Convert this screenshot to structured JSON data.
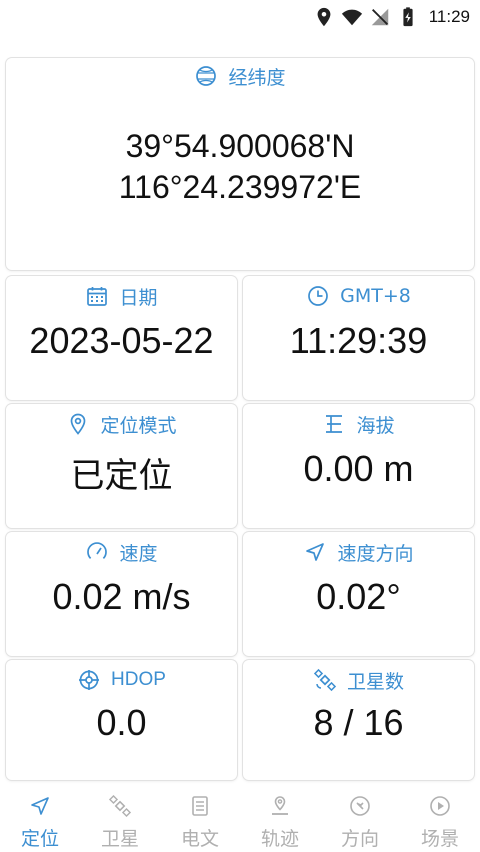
{
  "status_bar": {
    "time": "11:29"
  },
  "coordinates": {
    "label": "经纬度",
    "latitude": "39°54.900068'N",
    "longitude": "116°24.239972'E"
  },
  "cards": {
    "date": {
      "label": "日期",
      "value": "2023-05-22"
    },
    "timezone": {
      "label": "GMT+8",
      "value": "11:29:39"
    },
    "fix_mode": {
      "label": "定位模式",
      "value": "已定位"
    },
    "altitude": {
      "label": "海拔",
      "value": "0.00 m"
    },
    "speed": {
      "label": "速度",
      "value": "0.02 m/s"
    },
    "heading": {
      "label": "速度方向",
      "value": "0.02°"
    },
    "hdop": {
      "label": "HDOP",
      "value": "0.0"
    },
    "satellites": {
      "label": "卫星数",
      "value": "8 / 16"
    }
  },
  "nav": [
    {
      "label": "定位",
      "icon": "navigation-arrow-icon",
      "active": true
    },
    {
      "label": "卫星",
      "icon": "satellite-icon",
      "active": false
    },
    {
      "label": "电文",
      "icon": "document-icon",
      "active": false
    },
    {
      "label": "轨迹",
      "icon": "map-pin-track-icon",
      "active": false
    },
    {
      "label": "方向",
      "icon": "compass-icon",
      "active": false
    },
    {
      "label": "场景",
      "icon": "play-circle-icon",
      "active": false
    }
  ],
  "colors": {
    "accent": "#3d8fd1",
    "inactive": "#b0b0b0",
    "text": "#111111"
  }
}
